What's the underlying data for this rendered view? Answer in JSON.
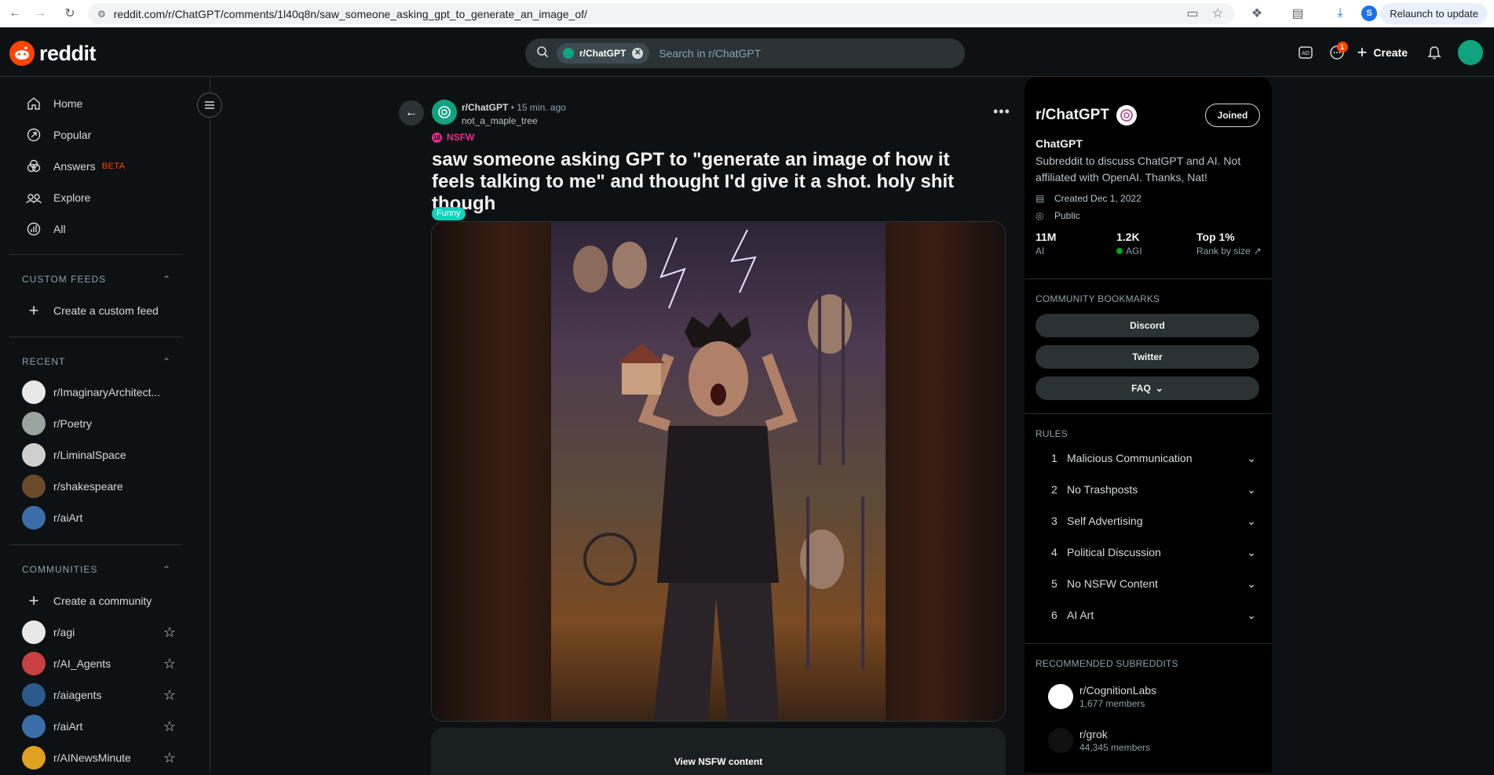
{
  "browser": {
    "url": "reddit.com/r/ChatGPT/comments/1l40q8n/saw_someone_asking_gpt_to_generate_an_image_of/",
    "profile_initial": "S",
    "relaunch_label": "Relaunch to update"
  },
  "header": {
    "logo_text": "reddit",
    "search_chip": "r/ChatGPT",
    "search_placeholder": "Search in r/ChatGPT",
    "chat_badge": "1",
    "create_label": "Create"
  },
  "sidebar": {
    "nav": [
      {
        "label": "Home",
        "icon": "home-icon"
      },
      {
        "label": "Popular",
        "icon": "popular-icon"
      },
      {
        "label": "Answers",
        "icon": "answers-icon",
        "badge": "BETA"
      },
      {
        "label": "Explore",
        "icon": "explore-icon"
      },
      {
        "label": "All",
        "icon": "all-icon"
      }
    ],
    "custom_feeds_heading": "CUSTOM FEEDS",
    "create_feed_label": "Create a custom feed",
    "recent_heading": "RECENT",
    "recent": [
      {
        "label": "r/ImaginaryArchitect...",
        "color": "#e8e8e8"
      },
      {
        "label": "r/Poetry",
        "color": "#9aa5a0"
      },
      {
        "label": "r/LiminalSpace",
        "color": "#cfcfcf"
      },
      {
        "label": "r/shakespeare",
        "color": "#6b4a2a"
      },
      {
        "label": "r/aiArt",
        "color": "#3b6ea8"
      }
    ],
    "communities_heading": "COMMUNITIES",
    "create_community_label": "Create a community",
    "communities": [
      {
        "label": "r/agi",
        "color": "#e8e8e8"
      },
      {
        "label": "r/AI_Agents",
        "color": "#c94040"
      },
      {
        "label": "r/aiagents",
        "color": "#2a5a8a"
      },
      {
        "label": "r/aiArt",
        "color": "#3b6ea8"
      },
      {
        "label": "r/AINewsMinute",
        "color": "#e0a020"
      }
    ]
  },
  "post": {
    "subreddit": "r/ChatGPT",
    "time": "15 min. ago",
    "author": "not_a_maple_tree",
    "nsfw_label": "NSFW",
    "title": "saw someone asking GPT to \"generate an image of how it feels talking to me\" and thought I'd give it a shot. holy shit though",
    "flair": "Funny",
    "view_nsfw_label": "View NSFW content"
  },
  "community": {
    "title": "r/ChatGPT",
    "joined_label": "Joined",
    "name": "ChatGPT",
    "description": "Subreddit to discuss ChatGPT and AI. Not affiliated with OpenAI. Thanks, Nat!",
    "created": "Created Dec 1, 2022",
    "visibility": "Public",
    "stats": [
      {
        "value": "11M",
        "label": "AI"
      },
      {
        "value": "1.2K",
        "label": "AGI"
      },
      {
        "value": "Top 1%",
        "label": "Rank by size"
      }
    ],
    "bookmarks_heading": "COMMUNITY BOOKMARKS",
    "bookmarks": [
      "Discord",
      "Twitter",
      "FAQ"
    ],
    "rules_heading": "RULES",
    "rules": [
      {
        "n": "1",
        "label": "Malicious Communication"
      },
      {
        "n": "2",
        "label": "No Trashposts"
      },
      {
        "n": "3",
        "label": "Self Advertising"
      },
      {
        "n": "4",
        "label": "Political Discussion"
      },
      {
        "n": "5",
        "label": "No NSFW Content"
      },
      {
        "n": "6",
        "label": "AI Art"
      }
    ],
    "recommended_heading": "RECOMMENDED SUBREDDITS",
    "recommended": [
      {
        "name": "r/CognitionLabs",
        "members": "1,677 members",
        "color": "#ffffff"
      },
      {
        "name": "r/grok",
        "members": "44,345 members",
        "color": "#111111"
      }
    ]
  }
}
